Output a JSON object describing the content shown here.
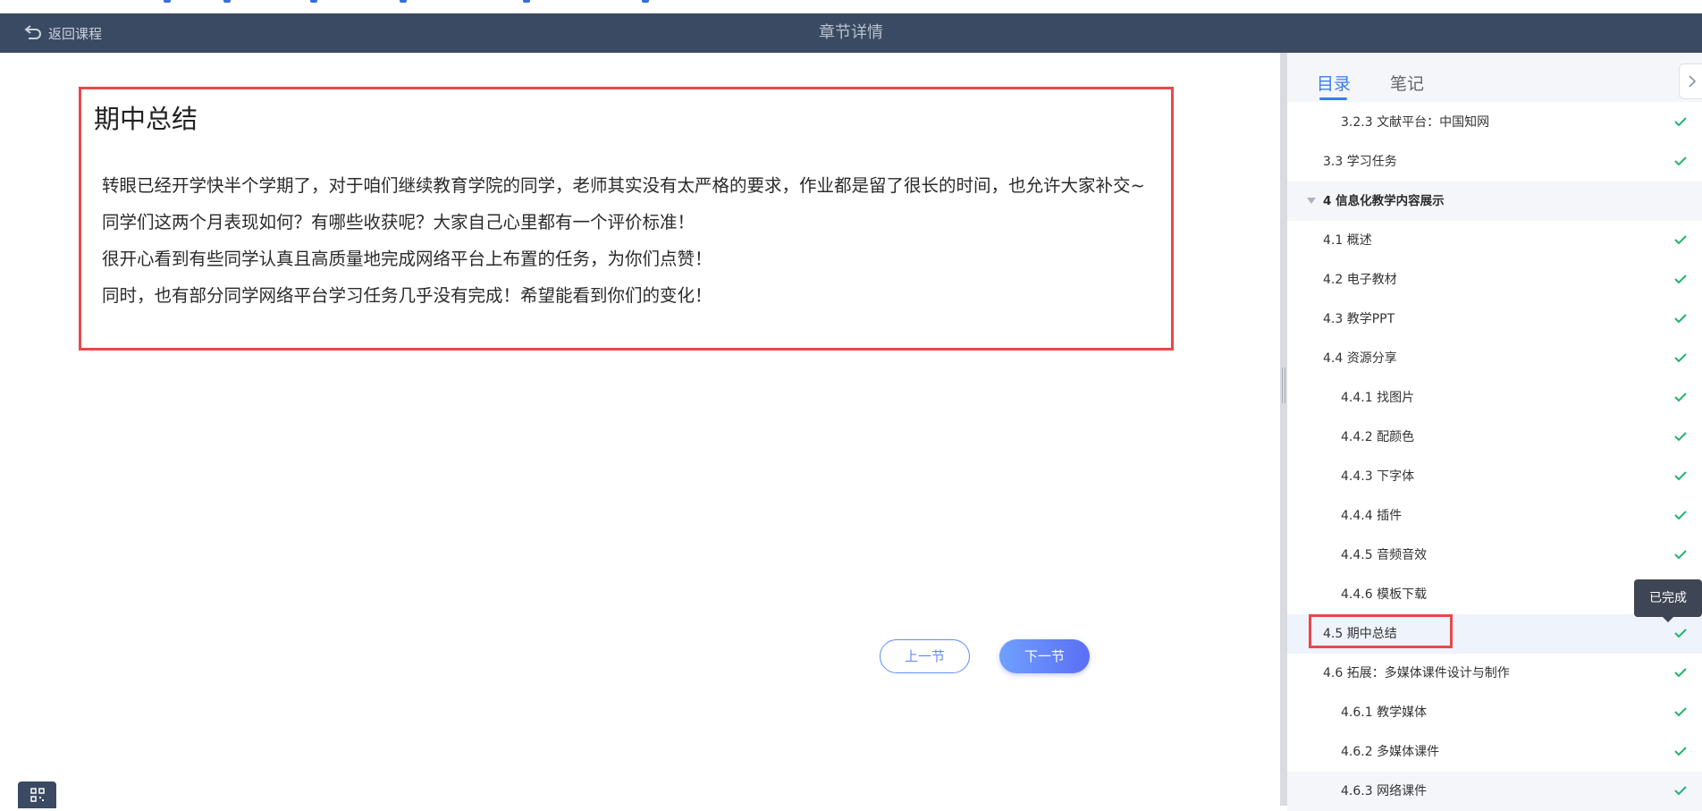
{
  "header": {
    "back_label": "返回课程",
    "title": "章节详情"
  },
  "article": {
    "title": "期中总结",
    "paragraphs": [
      "转眼已经开学快半个学期了，对于咱们继续教育学院的同学，老师其实没有太严格的要求，作业都是留了很长的时间，也允许大家补交~",
      "同学们这两个月表现如何？有哪些收获呢？大家自己心里都有一个评价标准！",
      "很开心看到有些同学认真且高质量地完成网络平台上布置的任务，为你们点赞！",
      "同时，也有部分同学网络平台学习任务几乎没有完成！希望能看到你们的变化！"
    ]
  },
  "nav": {
    "prev_label": "上一节",
    "next_label": "下一节"
  },
  "sidebar": {
    "tabs": [
      {
        "label": "目录"
      },
      {
        "label": "笔记"
      }
    ],
    "items": [
      {
        "label": "3.2.3 文献平台：中国知网",
        "completed": true
      },
      {
        "label": "3.3 学习任务",
        "completed": true
      },
      {
        "label": "4 信息化教学内容展示"
      },
      {
        "label": "4.1 概述",
        "completed": true
      },
      {
        "label": "4.2 电子教材",
        "completed": true
      },
      {
        "label": "4.3 教学PPT",
        "completed": true
      },
      {
        "label": "4.4 资源分享",
        "completed": true
      },
      {
        "label": "4.4.1 找图片",
        "completed": true
      },
      {
        "label": "4.4.2 配颜色",
        "completed": true
      },
      {
        "label": "4.4.3 下字体",
        "completed": true
      },
      {
        "label": "4.4.4 插件",
        "completed": true
      },
      {
        "label": "4.4.5 音频音效",
        "completed": true
      },
      {
        "label": "4.4.6 模板下载",
        "completed": true
      },
      {
        "label": "4.5 期中总结",
        "completed": true,
        "active": true
      },
      {
        "label": "4.6 拓展：多媒体课件设计与制作",
        "completed": true
      },
      {
        "label": "4.6.1 教学媒体",
        "completed": true
      },
      {
        "label": "4.6.2 多媒体课件",
        "completed": true
      },
      {
        "label": "4.6.3 网络课件",
        "completed": true
      }
    ],
    "tooltip": "已完成"
  },
  "colors": {
    "header_bg": "#3b4a63",
    "accent": "#3a7cf0",
    "check": "#23b26d",
    "highlight": "#e8484a"
  }
}
